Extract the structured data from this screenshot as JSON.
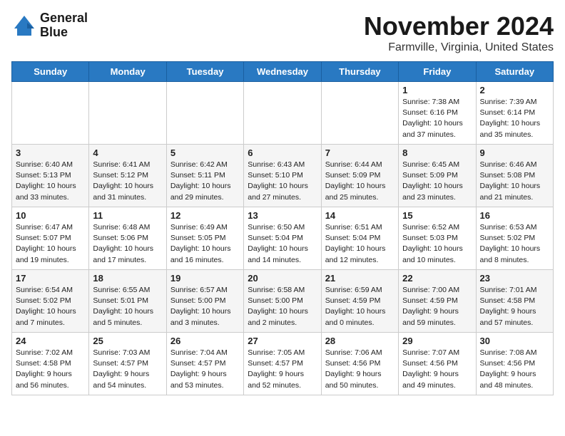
{
  "header": {
    "logo_line1": "General",
    "logo_line2": "Blue",
    "month": "November 2024",
    "location": "Farmville, Virginia, United States"
  },
  "columns": [
    "Sunday",
    "Monday",
    "Tuesday",
    "Wednesday",
    "Thursday",
    "Friday",
    "Saturday"
  ],
  "weeks": [
    [
      {
        "day": "",
        "info": ""
      },
      {
        "day": "",
        "info": ""
      },
      {
        "day": "",
        "info": ""
      },
      {
        "day": "",
        "info": ""
      },
      {
        "day": "",
        "info": ""
      },
      {
        "day": "1",
        "info": "Sunrise: 7:38 AM\nSunset: 6:16 PM\nDaylight: 10 hours and 37 minutes."
      },
      {
        "day": "2",
        "info": "Sunrise: 7:39 AM\nSunset: 6:14 PM\nDaylight: 10 hours and 35 minutes."
      }
    ],
    [
      {
        "day": "3",
        "info": "Sunrise: 6:40 AM\nSunset: 5:13 PM\nDaylight: 10 hours and 33 minutes."
      },
      {
        "day": "4",
        "info": "Sunrise: 6:41 AM\nSunset: 5:12 PM\nDaylight: 10 hours and 31 minutes."
      },
      {
        "day": "5",
        "info": "Sunrise: 6:42 AM\nSunset: 5:11 PM\nDaylight: 10 hours and 29 minutes."
      },
      {
        "day": "6",
        "info": "Sunrise: 6:43 AM\nSunset: 5:10 PM\nDaylight: 10 hours and 27 minutes."
      },
      {
        "day": "7",
        "info": "Sunrise: 6:44 AM\nSunset: 5:09 PM\nDaylight: 10 hours and 25 minutes."
      },
      {
        "day": "8",
        "info": "Sunrise: 6:45 AM\nSunset: 5:09 PM\nDaylight: 10 hours and 23 minutes."
      },
      {
        "day": "9",
        "info": "Sunrise: 6:46 AM\nSunset: 5:08 PM\nDaylight: 10 hours and 21 minutes."
      }
    ],
    [
      {
        "day": "10",
        "info": "Sunrise: 6:47 AM\nSunset: 5:07 PM\nDaylight: 10 hours and 19 minutes."
      },
      {
        "day": "11",
        "info": "Sunrise: 6:48 AM\nSunset: 5:06 PM\nDaylight: 10 hours and 17 minutes."
      },
      {
        "day": "12",
        "info": "Sunrise: 6:49 AM\nSunset: 5:05 PM\nDaylight: 10 hours and 16 minutes."
      },
      {
        "day": "13",
        "info": "Sunrise: 6:50 AM\nSunset: 5:04 PM\nDaylight: 10 hours and 14 minutes."
      },
      {
        "day": "14",
        "info": "Sunrise: 6:51 AM\nSunset: 5:04 PM\nDaylight: 10 hours and 12 minutes."
      },
      {
        "day": "15",
        "info": "Sunrise: 6:52 AM\nSunset: 5:03 PM\nDaylight: 10 hours and 10 minutes."
      },
      {
        "day": "16",
        "info": "Sunrise: 6:53 AM\nSunset: 5:02 PM\nDaylight: 10 hours and 8 minutes."
      }
    ],
    [
      {
        "day": "17",
        "info": "Sunrise: 6:54 AM\nSunset: 5:02 PM\nDaylight: 10 hours and 7 minutes."
      },
      {
        "day": "18",
        "info": "Sunrise: 6:55 AM\nSunset: 5:01 PM\nDaylight: 10 hours and 5 minutes."
      },
      {
        "day": "19",
        "info": "Sunrise: 6:57 AM\nSunset: 5:00 PM\nDaylight: 10 hours and 3 minutes."
      },
      {
        "day": "20",
        "info": "Sunrise: 6:58 AM\nSunset: 5:00 PM\nDaylight: 10 hours and 2 minutes."
      },
      {
        "day": "21",
        "info": "Sunrise: 6:59 AM\nSunset: 4:59 PM\nDaylight: 10 hours and 0 minutes."
      },
      {
        "day": "22",
        "info": "Sunrise: 7:00 AM\nSunset: 4:59 PM\nDaylight: 9 hours and 59 minutes."
      },
      {
        "day": "23",
        "info": "Sunrise: 7:01 AM\nSunset: 4:58 PM\nDaylight: 9 hours and 57 minutes."
      }
    ],
    [
      {
        "day": "24",
        "info": "Sunrise: 7:02 AM\nSunset: 4:58 PM\nDaylight: 9 hours and 56 minutes."
      },
      {
        "day": "25",
        "info": "Sunrise: 7:03 AM\nSunset: 4:57 PM\nDaylight: 9 hours and 54 minutes."
      },
      {
        "day": "26",
        "info": "Sunrise: 7:04 AM\nSunset: 4:57 PM\nDaylight: 9 hours and 53 minutes."
      },
      {
        "day": "27",
        "info": "Sunrise: 7:05 AM\nSunset: 4:57 PM\nDaylight: 9 hours and 52 minutes."
      },
      {
        "day": "28",
        "info": "Sunrise: 7:06 AM\nSunset: 4:56 PM\nDaylight: 9 hours and 50 minutes."
      },
      {
        "day": "29",
        "info": "Sunrise: 7:07 AM\nSunset: 4:56 PM\nDaylight: 9 hours and 49 minutes."
      },
      {
        "day": "30",
        "info": "Sunrise: 7:08 AM\nSunset: 4:56 PM\nDaylight: 9 hours and 48 minutes."
      }
    ]
  ]
}
